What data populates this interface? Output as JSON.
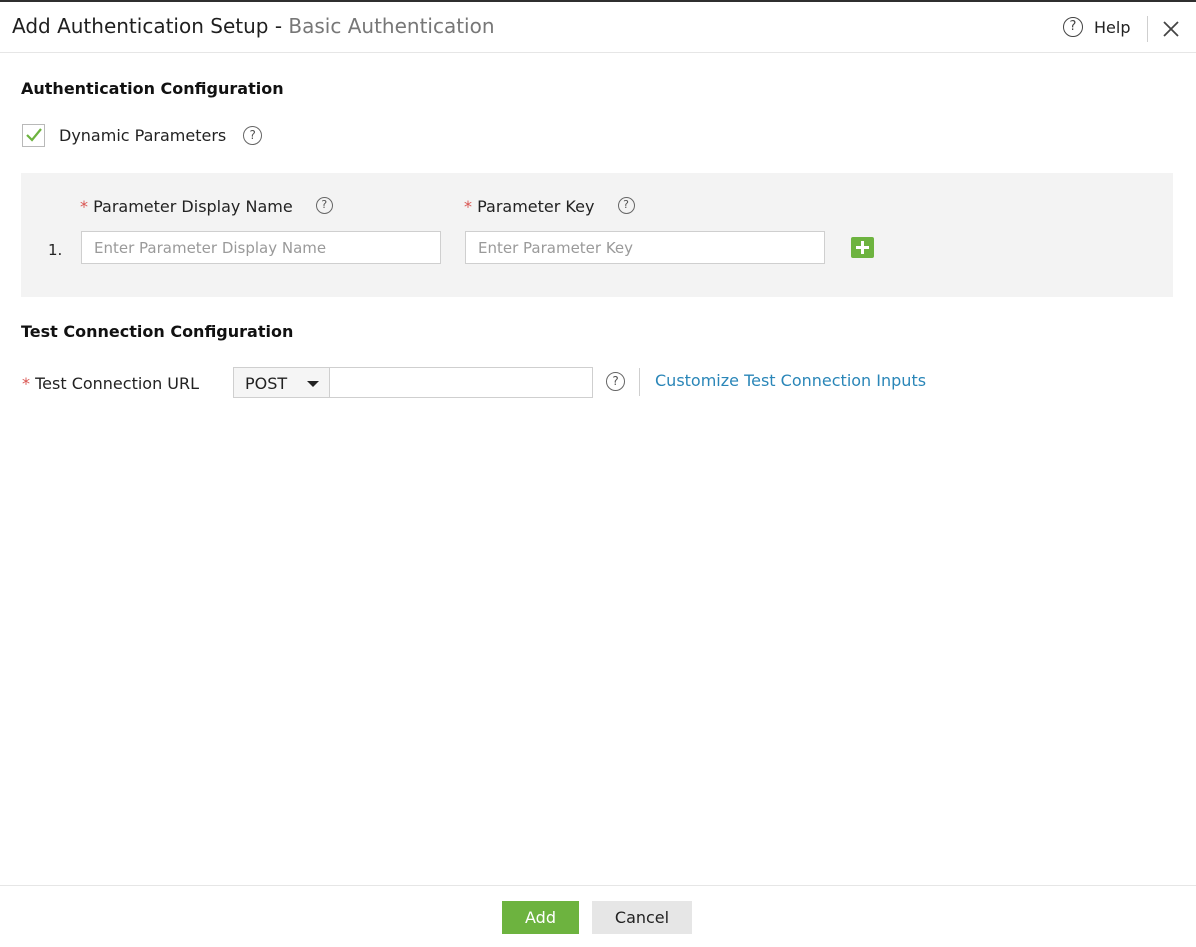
{
  "header": {
    "title": "Add Authentication Setup",
    "title_separator": "-",
    "subtitle": "Basic Authentication",
    "help_label": "Help"
  },
  "auth_config": {
    "section_title": "Authentication Configuration",
    "dynamic_parameters_label": "Dynamic Parameters",
    "dynamic_parameters_checked": true
  },
  "parameters": {
    "required_marker": "*",
    "display_name_label": "Parameter Display Name",
    "key_label": "Parameter Key",
    "rows": [
      {
        "number": "1.",
        "display_name_value": "",
        "display_name_placeholder": "Enter Parameter Display Name",
        "key_value": "",
        "key_placeholder": "Enter Parameter Key"
      }
    ]
  },
  "test_connection": {
    "section_title": "Test Connection Configuration",
    "required_marker": "*",
    "url_label": "Test Connection URL",
    "method_value": "POST",
    "url_value": "",
    "customize_link": "Customize Test Connection Inputs"
  },
  "footer": {
    "add_label": "Add",
    "cancel_label": "Cancel"
  },
  "icons": {
    "help": "question-circle-icon",
    "close": "close-icon",
    "checkbox": "checkmark-icon",
    "add_row": "plus-icon",
    "dropdown": "caret-down-icon"
  },
  "colors": {
    "accent_green": "#6db33f",
    "link_blue": "#2a86b8",
    "required_red": "#d9534f",
    "panel_gray": "#f3f3f3"
  }
}
